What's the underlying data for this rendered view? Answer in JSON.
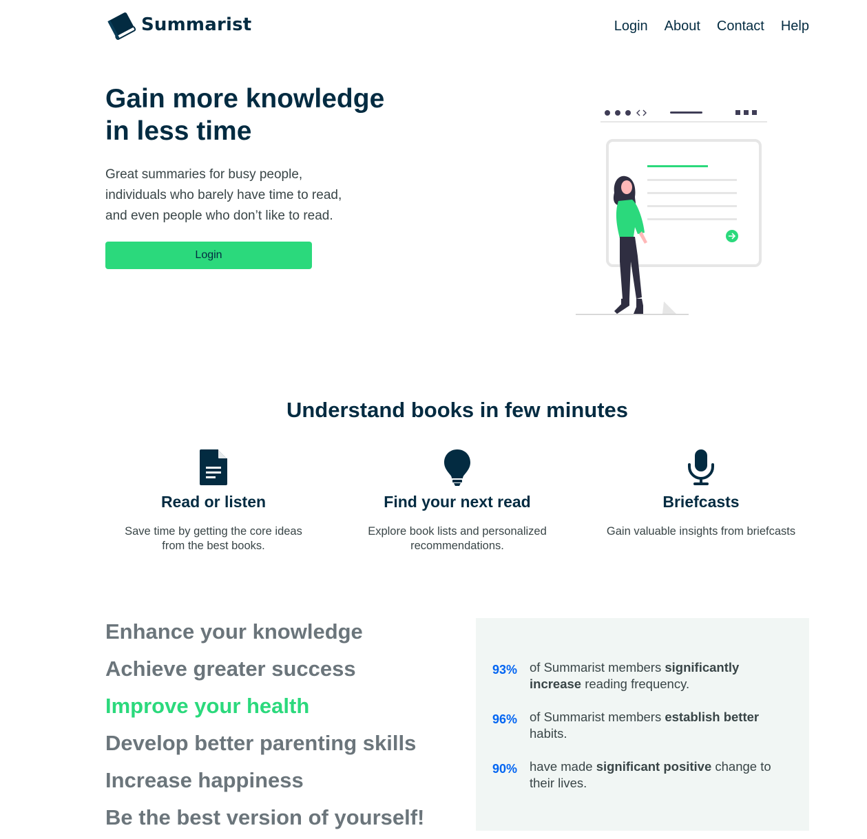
{
  "brand": {
    "name": "Summarist"
  },
  "nav": {
    "links": [
      "Login",
      "About",
      "Contact",
      "Help"
    ]
  },
  "hero": {
    "title_line1": "Gain more knowledge",
    "title_line2": "in less time",
    "subtitle_line1": "Great summaries for busy people,",
    "subtitle_line2": "individuals who barely have time to read,",
    "subtitle_line3": "and even people who don’t like to read.",
    "button": "Login"
  },
  "features": {
    "title": "Understand books in few minutes",
    "items": [
      {
        "icon": "document-icon",
        "title": "Read or listen",
        "desc_line1": "Save time by getting the core ideas",
        "desc_line2": "from the best books."
      },
      {
        "icon": "lightbulb-icon",
        "title": "Find your next read",
        "desc_line1": "Explore book lists and personalized",
        "desc_line2": "recommendations."
      },
      {
        "icon": "microphone-icon",
        "title": "Briefcasts",
        "desc_line1": "Gain valuable insights from briefcasts",
        "desc_line2": ""
      }
    ]
  },
  "headings": [
    "Enhance your knowledge",
    "Achieve greater success",
    "Improve your health",
    "Develop better parenting skills",
    "Increase happiness",
    "Be the best version of yourself!"
  ],
  "active_heading": "Improve your health",
  "stats": [
    {
      "num": "93%",
      "pre": "of Summarist members ",
      "bold": "significantly increase",
      "post": " reading frequency."
    },
    {
      "num": "96%",
      "pre": "of Summarist members ",
      "bold": "establish better",
      "post": " habits."
    },
    {
      "num": "90%",
      "pre": "have made ",
      "bold": "significant positive",
      "post": " change to their lives."
    }
  ],
  "colors": {
    "primary": "#032b41",
    "accent": "#2bd97c",
    "stat_blue": "#0365f2",
    "muted": "#6b757b",
    "panel": "#f1f6f4"
  }
}
